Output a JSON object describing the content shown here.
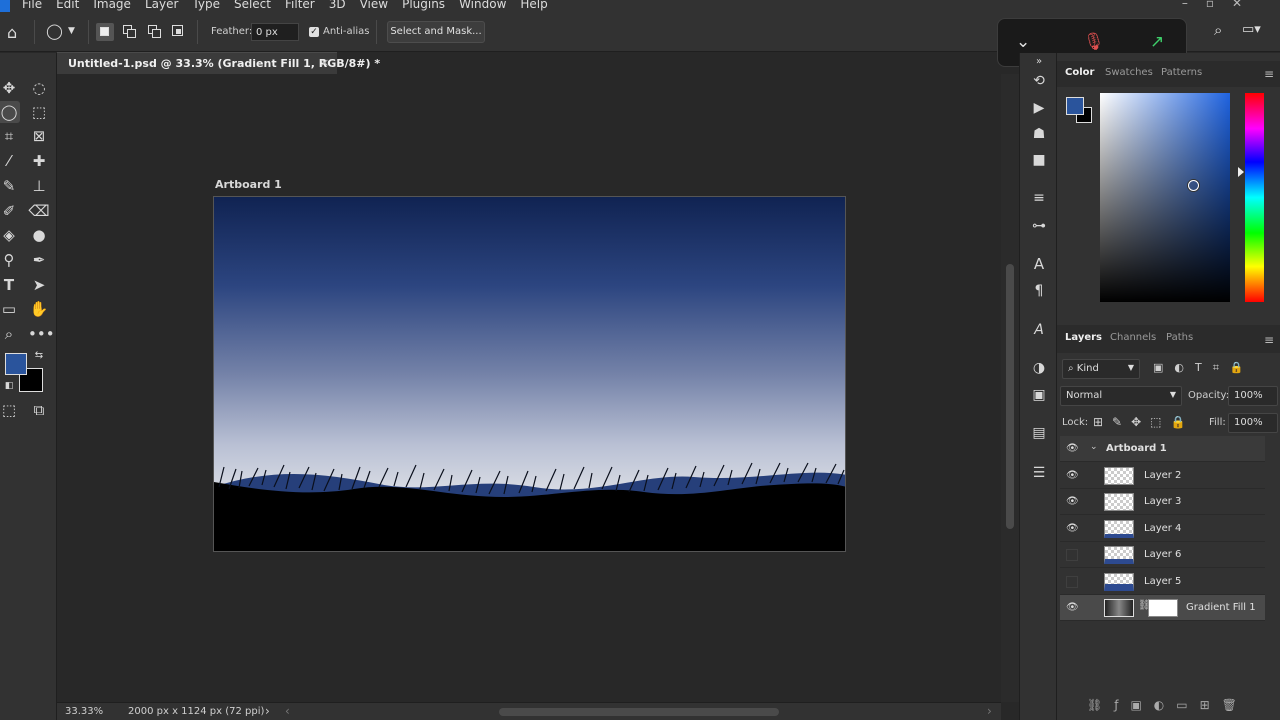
{
  "menu": {
    "items": [
      "File",
      "Edit",
      "Image",
      "Layer",
      "Type",
      "Select",
      "Filter",
      "3D",
      "View",
      "Plugins",
      "Window",
      "Help"
    ]
  },
  "options_bar": {
    "feather_label": "Feather:",
    "feather_value": "0 px",
    "antialias_label": "Anti-alias",
    "antialias_checked": true,
    "select_mask_label": "Select and Mask..."
  },
  "document": {
    "tab_title": "Untitled-1.psd @ 33.3% (Gradient Fill 1, RGB/8#) *",
    "artboard_label": "Artboard 1"
  },
  "status": {
    "zoom": "33.33%",
    "doc_size": "2000 px x 1124 px (72 ppi)"
  },
  "color_panel": {
    "tabs": [
      "Color",
      "Swatches",
      "Patterns"
    ],
    "foreground": "#2a549c",
    "background": "#000000"
  },
  "layers_panel": {
    "tabs": [
      "Layers",
      "Channels",
      "Paths"
    ],
    "filter_kind": "Kind",
    "blend_mode": "Normal",
    "opacity_label": "Opacity:",
    "opacity_value": "100%",
    "lock_label": "Lock:",
    "fill_label": "Fill:",
    "fill_value": "100%",
    "group_name": "Artboard 1",
    "layers": [
      {
        "name": "Layer 2",
        "visible": true
      },
      {
        "name": "Layer 3",
        "visible": true
      },
      {
        "name": "Layer 4",
        "visible": true
      },
      {
        "name": "Layer 6",
        "visible": false
      },
      {
        "name": "Layer 5",
        "visible": false
      },
      {
        "name": "Gradient Fill 1",
        "visible": true
      }
    ]
  },
  "icons": {
    "home": "home-icon",
    "lasso": "lasso-icon",
    "search": "search-icon",
    "microphone_muted": "microphone-muted-icon"
  }
}
